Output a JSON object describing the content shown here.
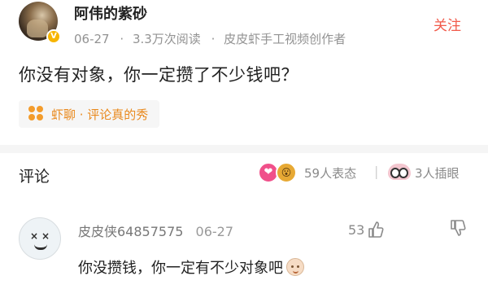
{
  "post": {
    "author": "阿伟的紫砂",
    "date": "06-27",
    "views": "3.3万次阅读",
    "author_title": "皮皮虾手工视频创作者",
    "separator": "·",
    "follow_label": "关注",
    "text": "你没有对象，你一定攒了不少钱吧？",
    "topic_label": "虾聊 · 评论真的秀",
    "avatar_icon": "user-avatar-photo",
    "verified_icon": "verified-badge-icon",
    "verified_glyph": "V"
  },
  "comments_header": {
    "title": "评论",
    "reactions_count": "59人表态",
    "separator": "|",
    "insert_count": "3人插眼",
    "reaction_icons": [
      "heart-react-icon",
      "emoji-react-icon"
    ],
    "heart_glyph": "❤",
    "face_glyph": "😮"
  },
  "comments": [
    {
      "user": "皮皮侠64857575",
      "date": "06-27",
      "likes": "53",
      "text": "你没攒钱，你一定有不少对象吧",
      "avatar_eye_glyph": "×"
    }
  ],
  "colors": {
    "accent_follow": "#f15a4a",
    "topic_orange": "#e98a1f",
    "verified": "#f7b500",
    "muted_text": "#939393"
  }
}
